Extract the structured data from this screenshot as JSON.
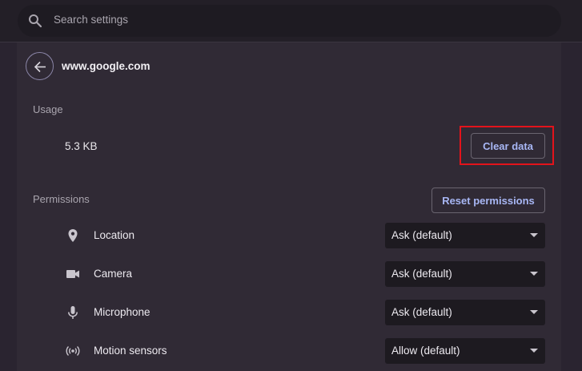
{
  "search": {
    "placeholder": "Search settings"
  },
  "site": {
    "title": "www.google.com"
  },
  "usage": {
    "label": "Usage",
    "value": "5.3 KB",
    "clear_button": "Clear data"
  },
  "permissions": {
    "label": "Permissions",
    "reset_button": "Reset permissions",
    "items": [
      {
        "label": "Location",
        "value": "Ask (default)",
        "icon": "location-icon"
      },
      {
        "label": "Camera",
        "value": "Ask (default)",
        "icon": "camera-icon"
      },
      {
        "label": "Microphone",
        "value": "Ask (default)",
        "icon": "microphone-icon"
      },
      {
        "label": "Motion sensors",
        "value": "Allow (default)",
        "icon": "motion-sensors-icon"
      }
    ]
  },
  "colors": {
    "background": "#2a2430",
    "accent_text": "#a8b7f5",
    "highlight_box": "#e3131b"
  }
}
